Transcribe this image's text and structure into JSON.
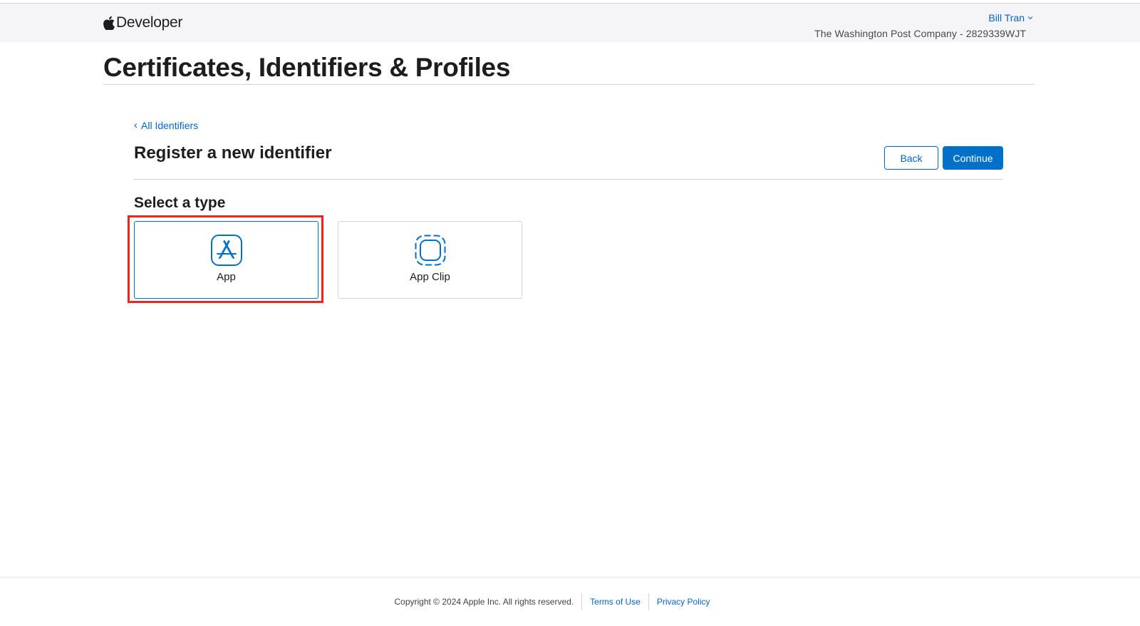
{
  "header": {
    "brand": "Developer",
    "account_name": "Bill Tran",
    "team": "The Washington Post Company - 2829339WJT"
  },
  "page": {
    "title": "Certificates, Identifiers & Profiles"
  },
  "main": {
    "back_link": "All Identifiers",
    "heading": "Register a new identifier",
    "back_button": "Back",
    "continue_button": "Continue",
    "select_type_label": "Select a type",
    "types": [
      {
        "label": "App",
        "icon": "app-store-icon",
        "selected": true
      },
      {
        "label": "App Clip",
        "icon": "app-clip-icon",
        "selected": false
      }
    ]
  },
  "footer": {
    "copyright": "Copyright © 2024 Apple Inc. All rights reserved.",
    "terms": "Terms of Use",
    "privacy": "Privacy Policy"
  },
  "colors": {
    "accent": "#0070c9",
    "link": "#0066cc",
    "highlight": "#e8281f"
  }
}
